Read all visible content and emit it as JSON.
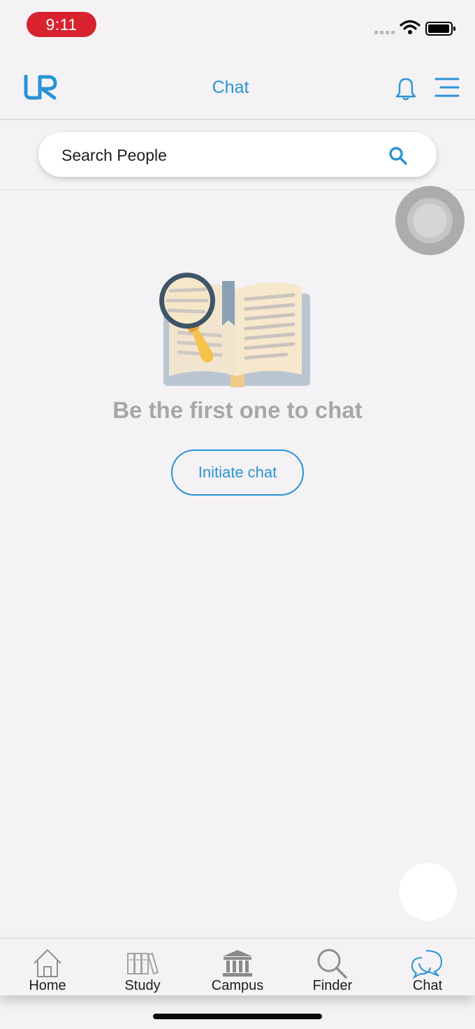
{
  "status_bar": {
    "time": "9:11"
  },
  "header": {
    "title": "Chat"
  },
  "search": {
    "placeholder": "Search People"
  },
  "empty_state": {
    "message": "Be the first one to chat",
    "button_label": "Initiate chat"
  },
  "tabs": [
    {
      "label": "Home",
      "icon": "home-icon"
    },
    {
      "label": "Study",
      "icon": "books-icon"
    },
    {
      "label": "Campus",
      "icon": "building-icon"
    },
    {
      "label": "Finder",
      "icon": "magnifier-icon"
    },
    {
      "label": "Chat",
      "icon": "chat-bubbles-icon",
      "active": true
    }
  ],
  "colors": {
    "accent": "#2a93d5",
    "time_pill": "#d8232f",
    "muted_text": "#a7a7a7"
  }
}
